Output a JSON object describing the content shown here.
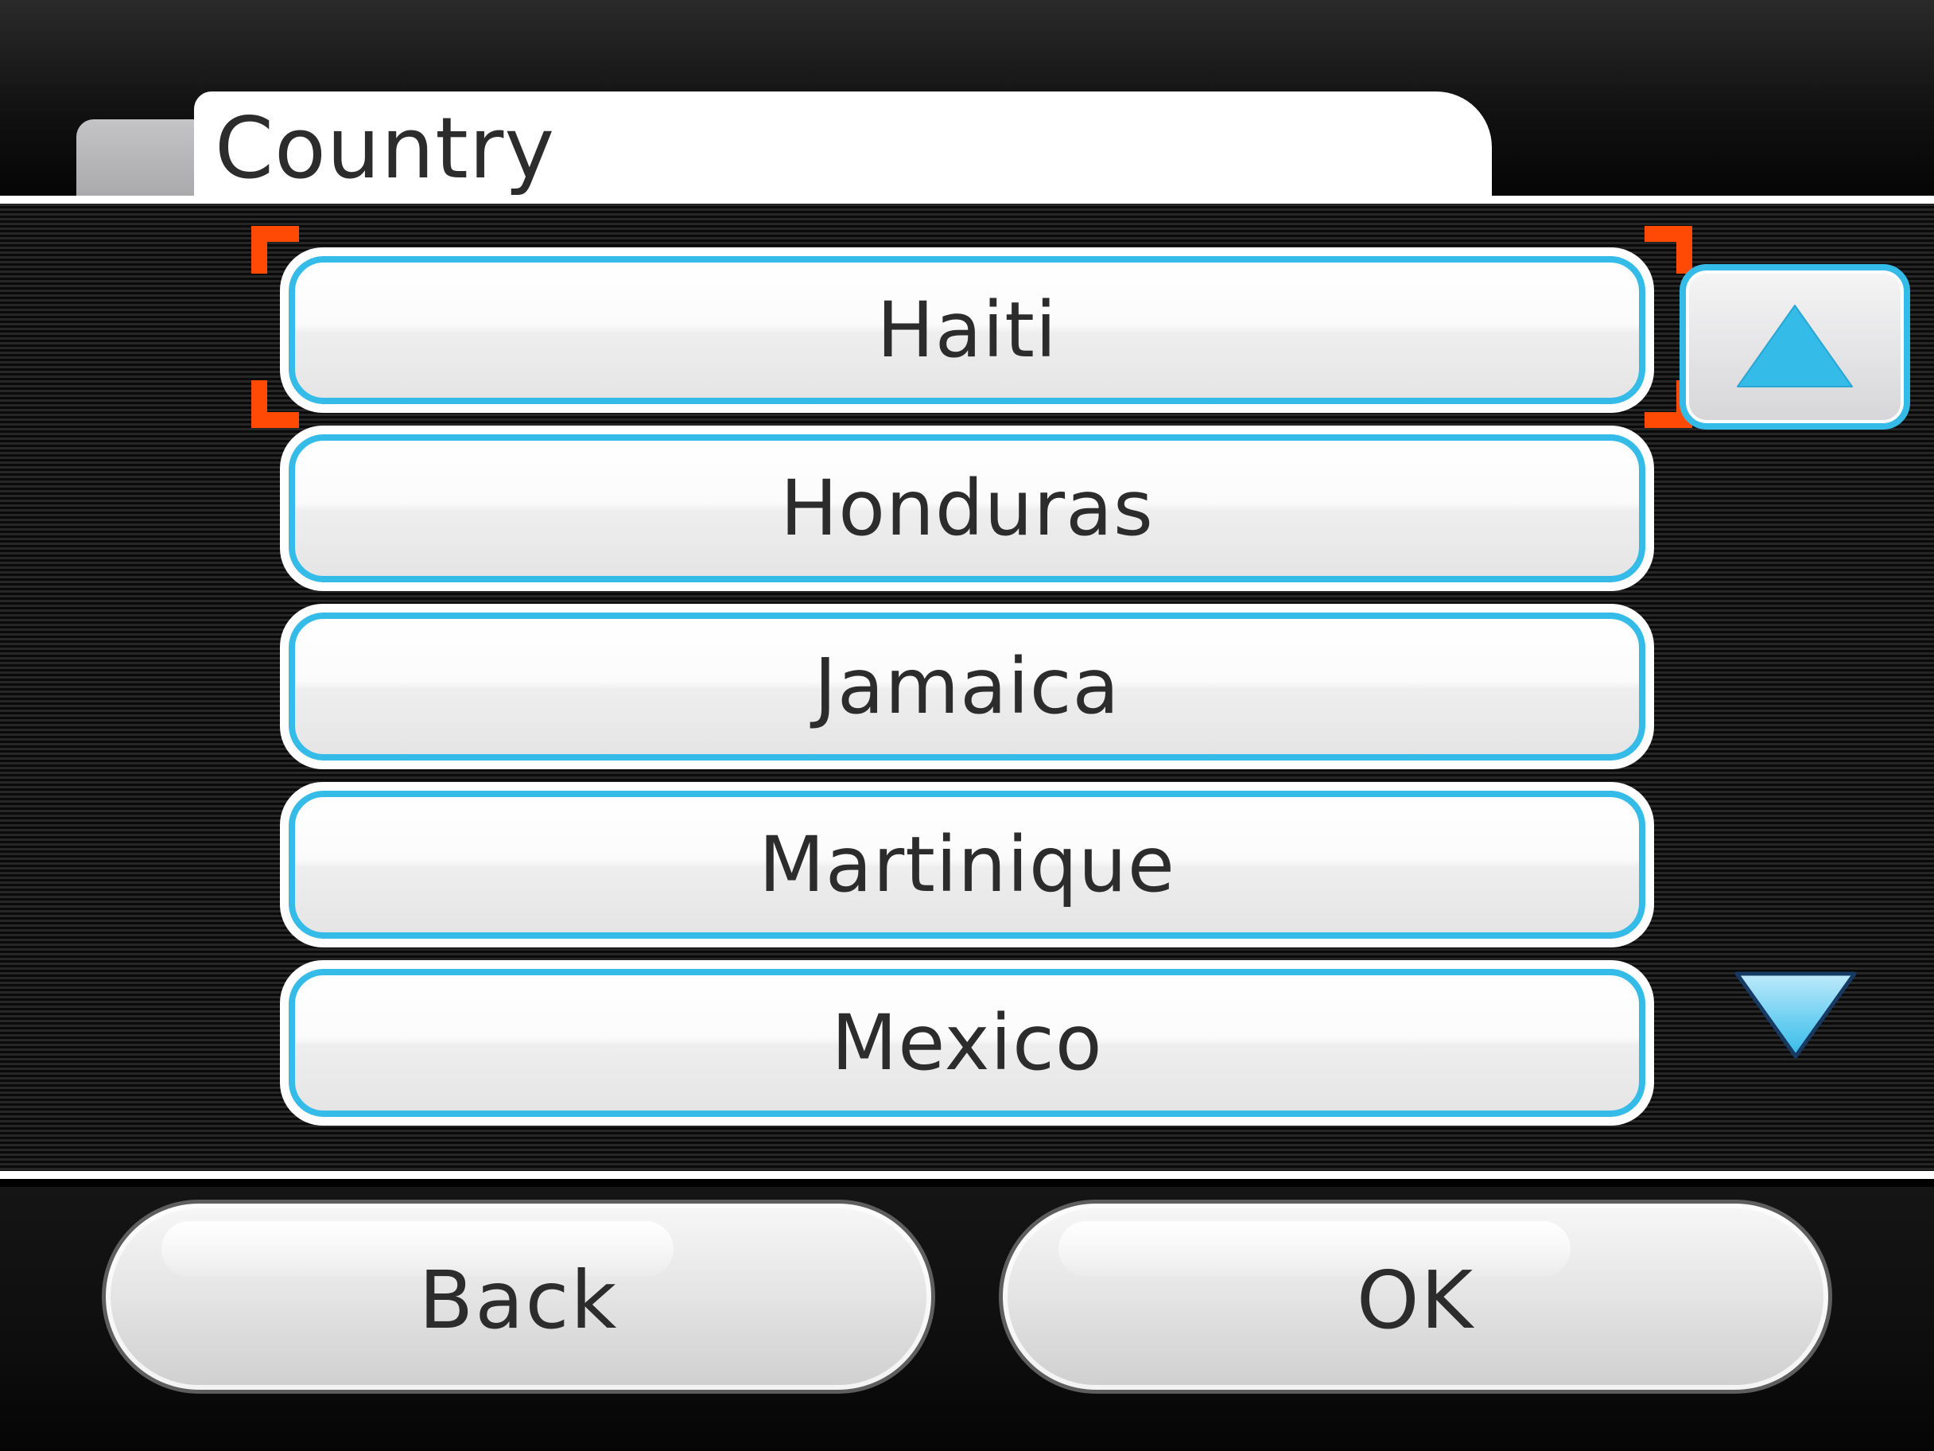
{
  "header": {
    "title": "Country"
  },
  "list": {
    "items": [
      {
        "label": "Haiti",
        "selected": true
      },
      {
        "label": "Honduras",
        "selected": false
      },
      {
        "label": "Jamaica",
        "selected": false
      },
      {
        "label": "Martinique",
        "selected": false
      },
      {
        "label": "Mexico",
        "selected": false
      }
    ],
    "scroll_up_icon": "arrow-up-icon",
    "scroll_down_icon": "arrow-down-icon"
  },
  "footer": {
    "back_label": "Back",
    "ok_label": "OK"
  },
  "colors": {
    "accent": "#35bbe8",
    "selection": "#ff4a06",
    "text": "#2c2c2c",
    "background": "#000000"
  }
}
